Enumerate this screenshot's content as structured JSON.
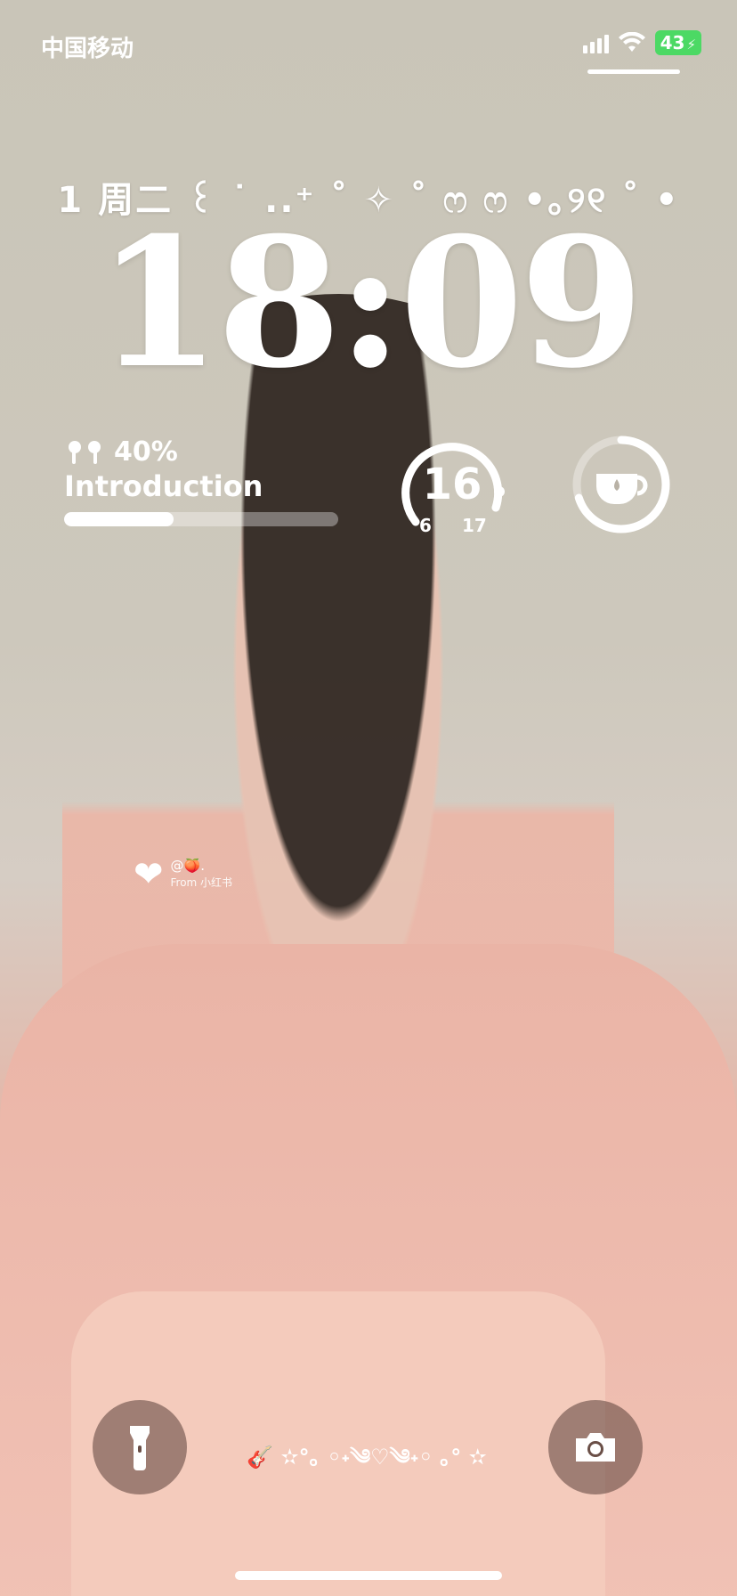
{
  "status_bar": {
    "carrier": "中国移动",
    "battery": "43",
    "battery_color": "#4cd964"
  },
  "lockscreen": {
    "date_line": "1 周二 ꒰ ˙ ..⁺ ˚ ✧ ˚ ෆ ෆ •｡୨୧ ˚ •",
    "time": "18:09"
  },
  "widgets": {
    "airpods": {
      "icon": "airpods-icon",
      "percent_label": "40%",
      "level": 0.4,
      "title": "Introduction"
    },
    "gauge": {
      "value": "16",
      "min": "6",
      "max": "17"
    },
    "tea_ring": {
      "icon": "teacup-icon",
      "level": 0.7
    }
  },
  "note": {
    "heart_icon": "heart-icon",
    "text": "@🍑.",
    "source": "From 小红书"
  },
  "dock": {
    "left_icon": "flashlight-icon",
    "right_icon": "camera-icon",
    "kaomoji": "🎸 ✫°｡ ◦˖༄♡༄˖◦ ｡° ✫"
  }
}
